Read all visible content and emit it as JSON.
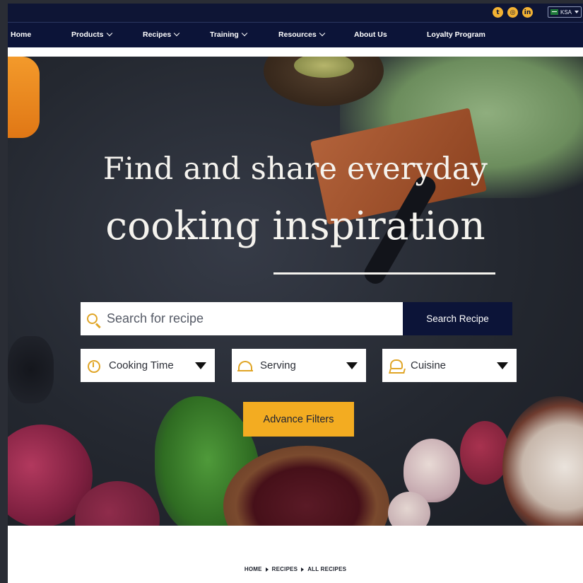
{
  "topbar": {
    "social": [
      {
        "icon": "twitter-icon",
        "glyph": "t"
      },
      {
        "icon": "instagram-icon",
        "glyph": "◎"
      },
      {
        "icon": "linkedin-icon",
        "glyph": "in"
      }
    ],
    "locale": {
      "label": "KSA",
      "flag_icon": "saudi-flag-icon"
    }
  },
  "nav": {
    "items": [
      {
        "label": "Home",
        "has_dropdown": false
      },
      {
        "label": "Products",
        "has_dropdown": true
      },
      {
        "label": "Recipes",
        "has_dropdown": true
      },
      {
        "label": "Training",
        "has_dropdown": true
      },
      {
        "label": "Resources",
        "has_dropdown": true
      },
      {
        "label": "About Us",
        "has_dropdown": false
      },
      {
        "label": "Loyalty Program",
        "has_dropdown": false
      }
    ]
  },
  "hero": {
    "headline_line1": "Find and share everyday",
    "headline_line2": "cooking inspiration",
    "search": {
      "placeholder": "Search for recipe",
      "value": "",
      "button_label": "Search Recipe"
    },
    "filters": [
      {
        "label": "Cooking Time",
        "icon": "clock-icon"
      },
      {
        "label": "Serving",
        "icon": "cloche-icon"
      },
      {
        "label": "Cuisine",
        "icon": "chef-hat-icon"
      }
    ],
    "advance_filters_label": "Advance Filters"
  },
  "breadcrumb": {
    "items": [
      "HOME",
      "RECIPES",
      "ALL RECIPES"
    ]
  },
  "colors": {
    "navy": "#0c1438",
    "accent": "#f3ac21",
    "icon_gold": "#e0a526"
  }
}
